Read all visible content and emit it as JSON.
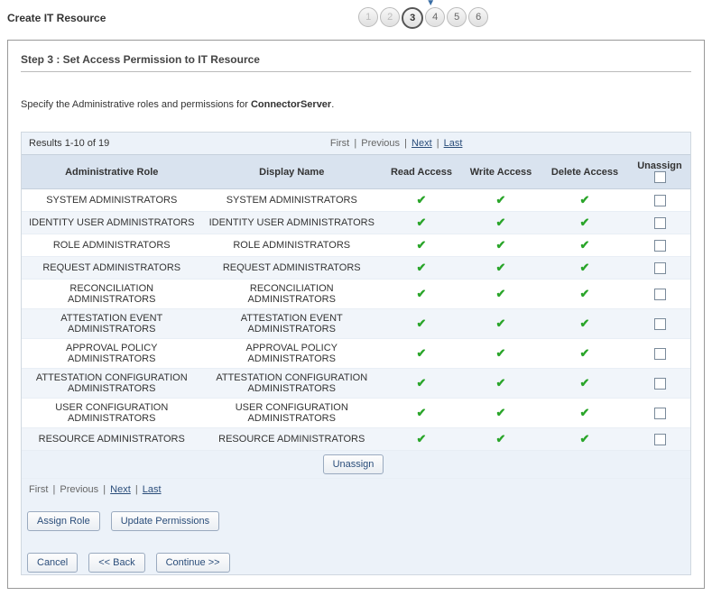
{
  "header": {
    "title": "Create IT Resource"
  },
  "wizard": {
    "steps": [
      "1",
      "2",
      "3",
      "4",
      "5",
      "6"
    ],
    "current": 3
  },
  "step_title": "Step 3 : Set Access Permission to IT Resource",
  "instruction_prefix": "Specify the Administrative roles and permissions for ",
  "instruction_bold": "ConnectorServer",
  "instruction_suffix": ".",
  "pager": {
    "results": "Results 1-10 of 19",
    "first": "First",
    "previous": "Previous",
    "next": "Next",
    "last": "Last"
  },
  "columns": {
    "role": "Administrative Role",
    "display": "Display Name",
    "read": "Read Access",
    "write": "Write Access",
    "delete": "Delete Access",
    "unassign": "Unassign"
  },
  "rows": [
    {
      "role": "SYSTEM ADMINISTRATORS",
      "display": "SYSTEM ADMINISTRATORS",
      "read": true,
      "write": true,
      "delete": true
    },
    {
      "role": "IDENTITY USER ADMINISTRATORS",
      "display": "IDENTITY USER ADMINISTRATORS",
      "read": true,
      "write": true,
      "delete": true
    },
    {
      "role": "ROLE ADMINISTRATORS",
      "display": "ROLE ADMINISTRATORS",
      "read": true,
      "write": true,
      "delete": true
    },
    {
      "role": "REQUEST ADMINISTRATORS",
      "display": "REQUEST ADMINISTRATORS",
      "read": true,
      "write": true,
      "delete": true
    },
    {
      "role": "RECONCILIATION ADMINISTRATORS",
      "display": "RECONCILIATION ADMINISTRATORS",
      "read": true,
      "write": true,
      "delete": true
    },
    {
      "role": "ATTESTATION EVENT ADMINISTRATORS",
      "display": "ATTESTATION EVENT ADMINISTRATORS",
      "read": true,
      "write": true,
      "delete": true
    },
    {
      "role": "APPROVAL POLICY ADMINISTRATORS",
      "display": "APPROVAL POLICY ADMINISTRATORS",
      "read": true,
      "write": true,
      "delete": true
    },
    {
      "role": "ATTESTATION CONFIGURATION ADMINISTRATORS",
      "display": "ATTESTATION CONFIGURATION ADMINISTRATORS",
      "read": true,
      "write": true,
      "delete": true
    },
    {
      "role": "USER CONFIGURATION ADMINISTRATORS",
      "display": "USER CONFIGURATION ADMINISTRATORS",
      "read": true,
      "write": true,
      "delete": true
    },
    {
      "role": "RESOURCE ADMINISTRATORS",
      "display": "RESOURCE ADMINISTRATORS",
      "read": true,
      "write": true,
      "delete": true
    }
  ],
  "buttons": {
    "unassign": "Unassign",
    "assign_role": "Assign Role",
    "update_permissions": "Update Permissions",
    "cancel": "Cancel",
    "back": "<< Back",
    "continue": "Continue >>"
  }
}
